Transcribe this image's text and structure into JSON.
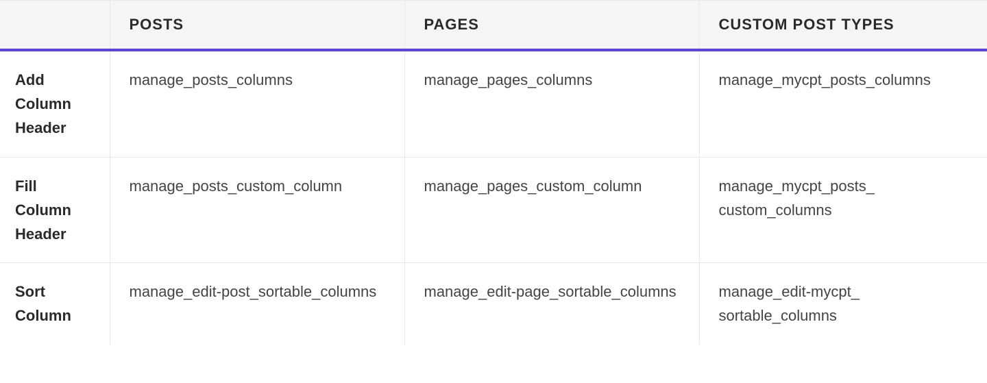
{
  "table": {
    "headers": {
      "col0": "",
      "col1": "POSTS",
      "col2": "PAGES",
      "col3": "CUSTOM POST TYPES"
    },
    "rows": [
      {
        "label": "Add Column Header",
        "posts": "manage_posts_columns",
        "pages": "manage_pages_columns",
        "cpt": "manage_mycpt_posts_​columns"
      },
      {
        "label": "Fill Column Header",
        "posts": "manage_posts_custom_​column",
        "pages": "manage_pages_custom_​column",
        "cpt": "manage_mycpt_posts_​custom_columns"
      },
      {
        "label": "Sort Column",
        "posts": "manage_edit-post_sortable​_columns",
        "pages": "manage_edit-page_sortable​_columns",
        "cpt": "manage_edit-mycpt_​sortable_columns"
      }
    ]
  }
}
